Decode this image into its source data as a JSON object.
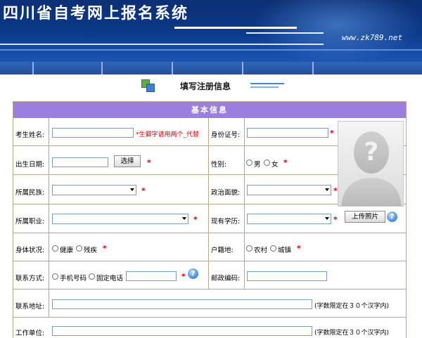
{
  "banner": {
    "title": "四川省自考网上报名系统",
    "url": "www.zk789.net"
  },
  "nav": {
    "segments": 6
  },
  "form_header": {
    "title": "填写注册信息"
  },
  "section": {
    "title": "基本信息"
  },
  "fields": {
    "name": {
      "label": "考生姓名:",
      "value": "",
      "hint": "*生僻字请用两个_代替"
    },
    "id_card": {
      "label": "身份证号:",
      "value": ""
    },
    "birthdate": {
      "label": "出生日期:",
      "value": "",
      "button": "选择"
    },
    "gender": {
      "label": "性别:",
      "options": [
        "男",
        "女"
      ]
    },
    "ethnicity": {
      "label": "所属民族:",
      "value": ""
    },
    "political": {
      "label": "政治面貌:",
      "value": ""
    },
    "occupation": {
      "label": "所属职业:",
      "value": ""
    },
    "education": {
      "label": "现有学历:",
      "value": ""
    },
    "health": {
      "label": "身体状况:",
      "options": [
        "健康",
        "残疾"
      ]
    },
    "hukou": {
      "label": "户籍地:",
      "options": [
        "农村",
        "城镇"
      ]
    },
    "contact": {
      "label": "联系方式:",
      "options": [
        "手机号码",
        "固定电话"
      ],
      "value": ""
    },
    "postcode": {
      "label": "邮政编码:",
      "value": ""
    },
    "address": {
      "label": "联系地址:",
      "value": "",
      "note": "(字数限定在３０个汉字内)"
    },
    "workplace": {
      "label": "工作单位:",
      "value": "",
      "note": "(字数限定在３０个汉字内)"
    }
  },
  "photo": {
    "upload_button": "上传照片"
  },
  "required_mark": "*",
  "help_glyph": "?",
  "colors": {
    "banner": "#0d3a8c",
    "nav": "#2f65b8",
    "section_bar": "#9a7fe0",
    "border": "#b9a98a",
    "required": "#d40000"
  }
}
